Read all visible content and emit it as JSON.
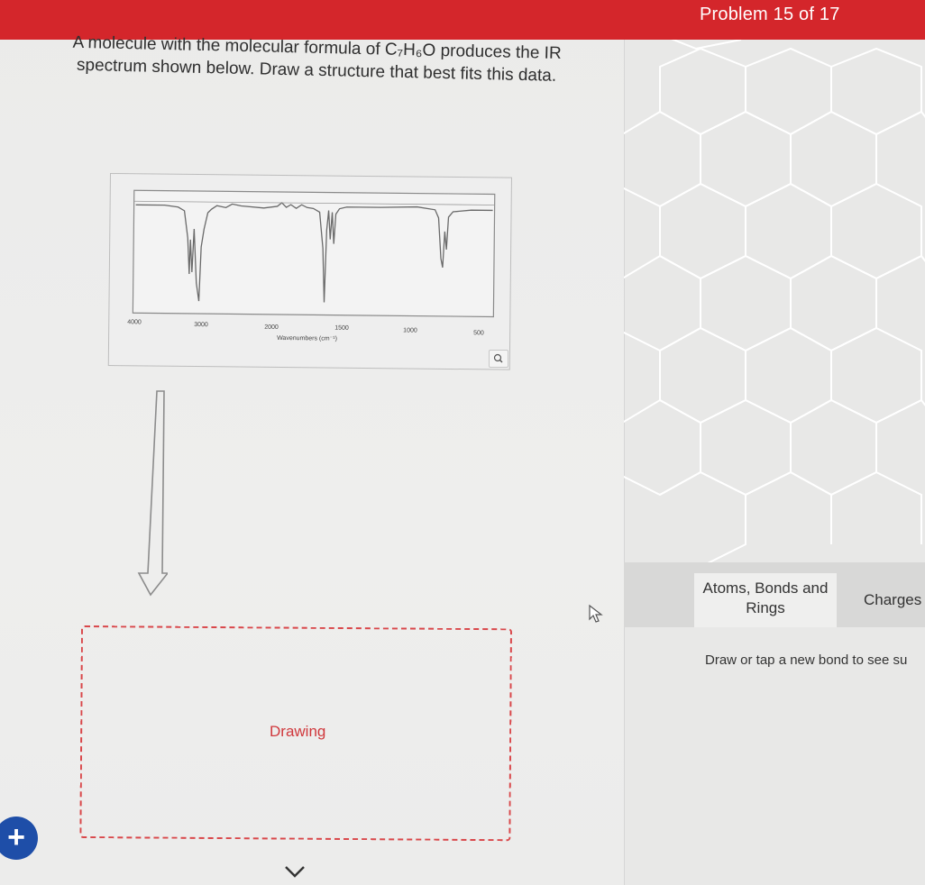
{
  "header": {
    "problem_counter": "Problem 15 of 17"
  },
  "question": {
    "text": "A molecule with the molecular formula of C₇H₆O produces the IR spectrum shown below. Draw a structure that best fits this data."
  },
  "spectrum": {
    "x_ticks": [
      "4000",
      "3000",
      "2000",
      "1500",
      "1000",
      "500"
    ],
    "x_label": "Wavenumbers (cm⁻¹)",
    "zoom_icon": "magnifier-icon"
  },
  "drawing": {
    "label": "Drawing"
  },
  "tabs": {
    "atoms_bonds_rings": "Atoms, Bonds and Rings",
    "charges": "Charges"
  },
  "hint": {
    "text": "Draw or tap a new bond to see su"
  },
  "icons": {
    "add": "+",
    "down_arrow": "down-arrow-icon",
    "chevron": "chevron-down-icon",
    "cursor": "cursor-icon"
  },
  "colors": {
    "header": "#d4262b",
    "dashed_border": "#d9474a",
    "fab": "#1e4ea8"
  }
}
